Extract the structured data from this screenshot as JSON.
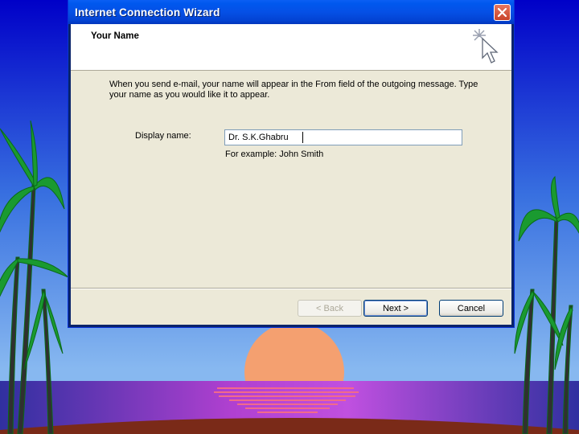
{
  "window": {
    "title": "Internet Connection Wizard"
  },
  "header": {
    "title": "Your Name",
    "icon": "wizard-cursor-icon"
  },
  "body": {
    "instructions": "When you send e-mail, your name will appear in the From field of the outgoing message. Type your name as you would like it to appear.",
    "display_name_label": "Display name:",
    "display_name_value": "Dr. S.K.Ghabru",
    "example_text": "For example: John Smith"
  },
  "buttons": {
    "back": "< Back",
    "next": "Next >",
    "cancel": "Cancel"
  },
  "colors": {
    "sky_top": "#0000c8",
    "sky_bottom": "#87b8f0",
    "sea": "#c060e0",
    "sun": "#f4a070",
    "titlebar": "#0050e0"
  }
}
